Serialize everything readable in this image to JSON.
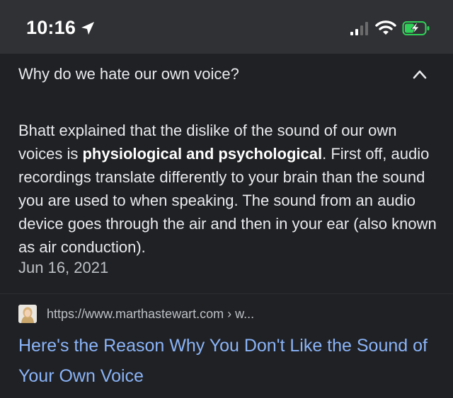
{
  "status_bar": {
    "time": "10:16",
    "icons": [
      "location-arrow-icon",
      "cellular-signal-icon",
      "wifi-icon",
      "battery-charging-icon"
    ]
  },
  "question": {
    "text": "Why do we hate our own voice?",
    "toggle_icon": "chevron-up-icon"
  },
  "answer": {
    "text_before": "Bhatt explained that the dislike of the sound of our own voices is ",
    "text_bold": "physiological and psychological",
    "text_after": ". First off, audio recordings translate differently to your brain than the sound you are used to when speaking. The sound from an audio device goes through the air and then in your ear (also known as air conduction).",
    "date": "Jun 16, 2021"
  },
  "source": {
    "favicon": "site-favicon",
    "url": "https://www.marthastewart.com › w...",
    "title": "Here's the Reason Why You Don't Like the Sound of Your Own Voice"
  },
  "colors": {
    "background": "#202124",
    "status_bar": "#303134",
    "text": "#e8eaed",
    "link": "#8ab4f8",
    "secondary_text": "#bdc1c6",
    "battery_charging": "#30d158"
  }
}
